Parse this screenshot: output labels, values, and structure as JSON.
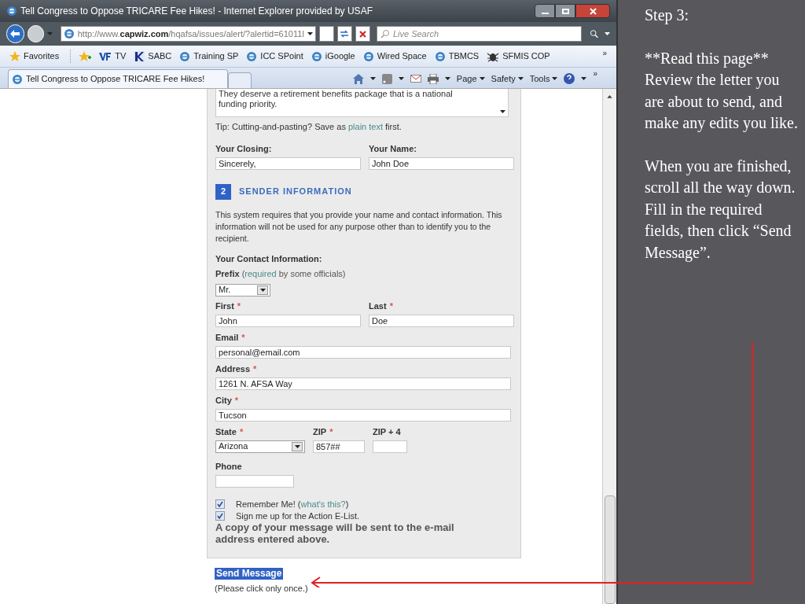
{
  "window": {
    "title": "Tell Congress to Oppose TRICARE Fee Hikes! - Internet Explorer provided by USAF"
  },
  "address_bar": {
    "url": "http://www.**capwiz.com**/hqafsa/issues/alert/?alertid=61011l"
  },
  "search": {
    "placeholder": "Live Search"
  },
  "favorites": {
    "label": "Favorites",
    "links": [
      {
        "label": "TV",
        "kind": "vf"
      },
      {
        "label": "SABC",
        "kind": "k"
      },
      {
        "label": "Training SP",
        "kind": "ie"
      },
      {
        "label": "ICC SPoint",
        "kind": "ie"
      },
      {
        "label": "iGoogle",
        "kind": "ie"
      },
      {
        "label": "Wired Space",
        "kind": "ie"
      },
      {
        "label": "TBMCS",
        "kind": "ie"
      },
      {
        "label": "SFMIS COP",
        "kind": "bug"
      }
    ],
    "overflow": "»"
  },
  "tabs": [
    {
      "label": "Tell Congress to Oppose TRICARE Fee Hikes!",
      "selected": true
    }
  ],
  "command_bar": [
    "Page",
    "Safety",
    "Tools"
  ],
  "command_overflow": "»",
  "form": {
    "message_lines": [
      "They deserve a retirement benefits package that is a national",
      "funding priority."
    ],
    "tip": {
      "before": "Tip: Cutting-and-pasting? Save as ",
      "link": "plain text",
      "after": " first."
    },
    "closing": {
      "label": "Your Closing:",
      "value": "Sincerely,"
    },
    "name": {
      "label": "Your Name:",
      "value": "John Doe"
    },
    "section": {
      "number": "2",
      "title": "SENDER INFORMATION"
    },
    "intro": "This system requires that you provide your name and contact information. This information will not be used for any purpose other than to identify you to the recipient.",
    "contact_heading": "Your Contact Information:",
    "prefix": {
      "label": "Prefix",
      "note_before": "(",
      "note_link": "required",
      "note_after": " by some officials)",
      "value": "Mr."
    },
    "first": {
      "label": "First",
      "required_mark": "*",
      "value": "John"
    },
    "last": {
      "label": "Last",
      "required_mark": "*",
      "value": "Doe"
    },
    "email": {
      "label": "Email",
      "required_mark": "*",
      "value": "personal@email.com"
    },
    "address": {
      "label": "Address",
      "required_mark": "*",
      "value": "1261 N. AFSA Way"
    },
    "city": {
      "label": "City",
      "required_mark": "*",
      "value": "Tucson"
    },
    "state": {
      "label": "State",
      "required_mark": "*",
      "value": "Arizona"
    },
    "zip": {
      "label": "ZIP",
      "required_mark": "*",
      "value": "857##"
    },
    "zip4": {
      "label": "ZIP + 4"
    },
    "phone": {
      "label": "Phone"
    },
    "checkboxes": [
      {
        "label": "Remember Me! (",
        "link": "what's this?",
        "after": ")",
        "checked": true
      },
      {
        "label": "Sign me up for the Action E-List.",
        "checked": true
      }
    ],
    "copy_note": "A copy of your message will be sent to the e-mail address entered above.",
    "send_button": "Send Message",
    "send_note": "(Please click only once.)"
  },
  "slide": {
    "step": "Step 3:",
    "paragraphs": [
      [
        "**Read this page**",
        "Review the letter you are about to send, and make any edits you like."
      ],
      [
        "When you are finished, scroll all the way down.",
        "Fill in the required fields, then click “Send Message”."
      ]
    ]
  }
}
